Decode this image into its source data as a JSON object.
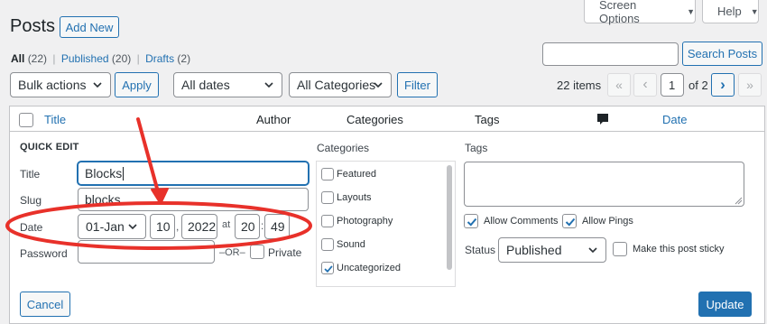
{
  "header": {
    "title": "Posts",
    "add_new": "Add New",
    "screen_options": "Screen Options",
    "help": "Help"
  },
  "filters": {
    "all_label": "All",
    "all_count": "(22)",
    "sep1": "|",
    "published_label": "Published",
    "published_count": "(20)",
    "sep2": "|",
    "drafts_label": "Drafts",
    "drafts_count": "(2)"
  },
  "search": {
    "value": "",
    "button": "Search Posts"
  },
  "toolbar": {
    "bulk_actions": "Bulk actions",
    "apply": "Apply",
    "dates": "All dates",
    "categories": "All Categories",
    "filter": "Filter"
  },
  "pagination": {
    "items": "22 items",
    "first": "«",
    "prev": "‹",
    "current": "1",
    "of_label": "of 2",
    "next": "›",
    "last": "»"
  },
  "table_header": {
    "title": "Title",
    "author": "Author",
    "categories": "Categories",
    "tags": "Tags",
    "date": "Date"
  },
  "quick_edit": {
    "heading": "QUICK EDIT",
    "title_label": "Title",
    "title_value": "Blocks",
    "slug_label": "Slug",
    "slug_value": "blocks",
    "date_label": "Date",
    "month": "01-Jan",
    "day": "10",
    "comma": ",",
    "year": "2022",
    "at": "at",
    "hour": "20",
    "colon": ":",
    "minute": "49",
    "password_label": "Password",
    "password_value": "",
    "or_label": "–OR–",
    "private_label": "Private",
    "categories_heading": "Categories",
    "categories": [
      {
        "label": "Featured",
        "checked": false
      },
      {
        "label": "Layouts",
        "checked": false
      },
      {
        "label": "Photography",
        "checked": false
      },
      {
        "label": "Sound",
        "checked": false
      },
      {
        "label": "Uncategorized",
        "checked": true
      }
    ],
    "tags_heading": "Tags",
    "tags_value": "",
    "allow_comments": "Allow Comments",
    "allow_pings": "Allow Pings",
    "status_label": "Status",
    "status_value": "Published",
    "sticky_label": "Make this post sticky",
    "cancel": "Cancel",
    "update": "Update"
  },
  "colors": {
    "accent": "#2271b1",
    "annotation": "#e8312a",
    "background": "#f0f0f1"
  }
}
